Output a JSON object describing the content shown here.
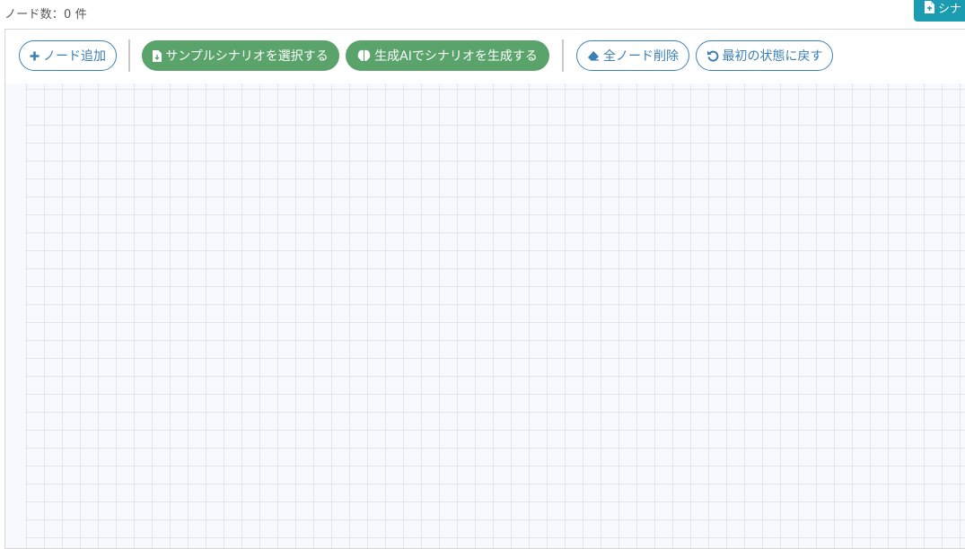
{
  "header": {
    "node_count": "ノード数：0 件",
    "top_right_button": "シナ"
  },
  "toolbar": {
    "add_node": "ノード追加",
    "select_sample": "サンプルシナリオを選択する",
    "generate_ai": "生成AIでシナリオを生成する",
    "delete_all": "全ノード削除",
    "reset": "最初の状態に戻す"
  },
  "colors": {
    "outline_button": "#3b82b8",
    "filled_button": "#5aa36b",
    "top_button": "#1b9cb0",
    "canvas_bg": "#f6f9fd",
    "grid_line": "#e0e6ee"
  },
  "icons": {
    "add_node": "plus-icon",
    "select_sample": "file-download-icon",
    "generate_ai": "brain-icon",
    "delete_all": "eraser-icon",
    "reset": "undo-icon",
    "top_right": "file-import-icon"
  }
}
